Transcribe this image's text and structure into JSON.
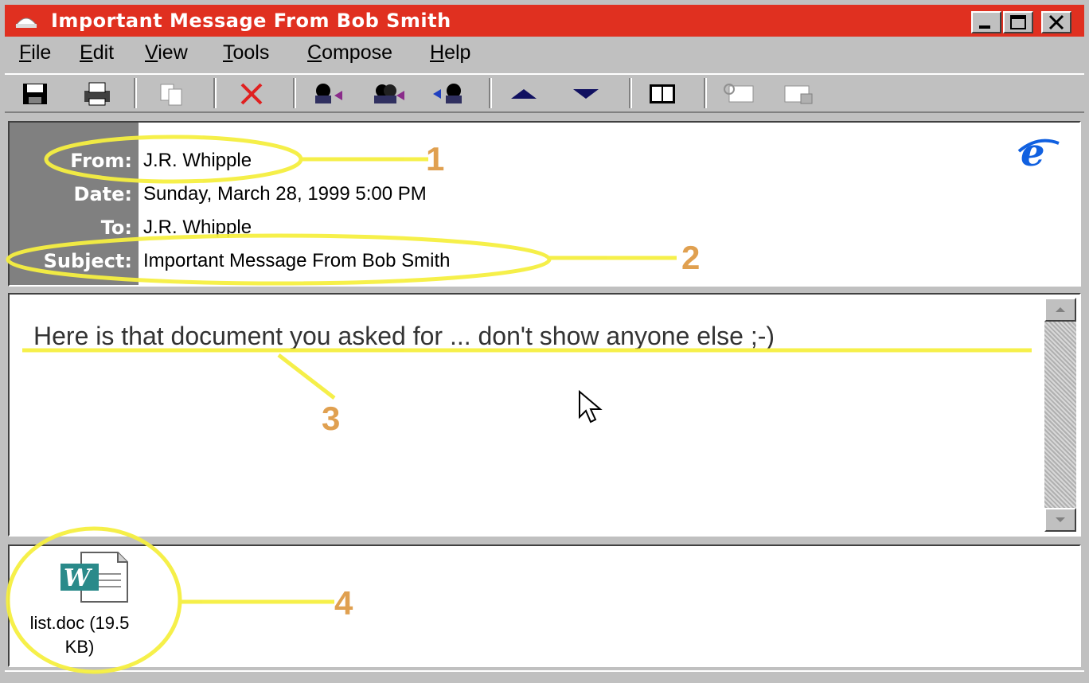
{
  "window": {
    "title": "Important Message From Bob Smith"
  },
  "menu": {
    "items": [
      "File",
      "Edit",
      "View",
      "Tools",
      "Compose",
      "Help"
    ]
  },
  "toolbar": {
    "buttons": [
      "save-icon",
      "print-icon",
      "copy-icon",
      "delete-icon",
      "reply-icon",
      "reply-all-icon",
      "forward-icon",
      "previous-icon",
      "next-icon",
      "address-book-icon",
      "sign-icon",
      "encrypt-icon"
    ]
  },
  "header": {
    "from_label": "From:",
    "from_value": "J.R. Whipple",
    "date_label": "Date:",
    "date_value": "Sunday, March 28, 1999 5:00 PM",
    "to_label": "To:",
    "to_value": "J.R. Whipple",
    "subject_label": "Subject:",
    "subject_value": "Important Message From Bob Smith"
  },
  "body": {
    "text": "Here is that document you asked for ... don't show anyone else ;-)"
  },
  "attachment": {
    "name_line1": "list.doc (19.5",
    "name_line2": "KB)"
  },
  "annotations": [
    "1",
    "2",
    "3",
    "4"
  ],
  "colors": {
    "titlebar": "#e03020",
    "highlight": "#f5ef40",
    "annotation_number": "#e0a050"
  }
}
